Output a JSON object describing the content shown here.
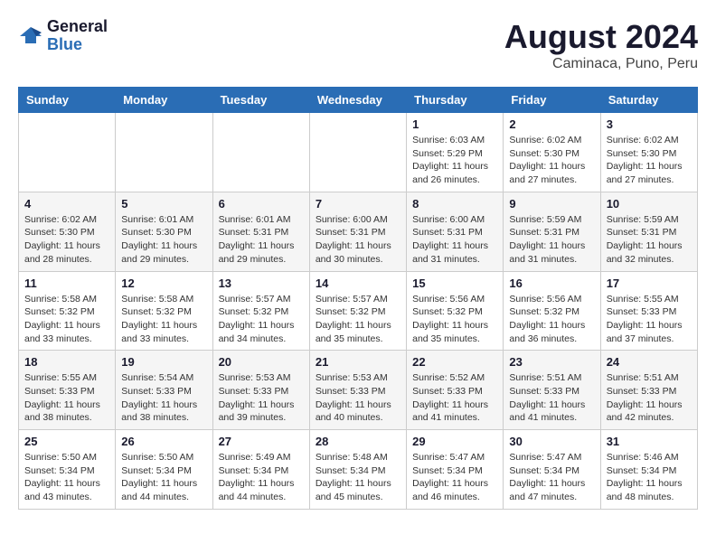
{
  "header": {
    "logo_line1": "General",
    "logo_line2": "Blue",
    "month_year": "August 2024",
    "location": "Caminaca, Puno, Peru"
  },
  "days_of_week": [
    "Sunday",
    "Monday",
    "Tuesday",
    "Wednesday",
    "Thursday",
    "Friday",
    "Saturday"
  ],
  "weeks": [
    [
      {
        "day": "",
        "info": ""
      },
      {
        "day": "",
        "info": ""
      },
      {
        "day": "",
        "info": ""
      },
      {
        "day": "",
        "info": ""
      },
      {
        "day": "1",
        "info": "Sunrise: 6:03 AM\nSunset: 5:29 PM\nDaylight: 11 hours and 26 minutes."
      },
      {
        "day": "2",
        "info": "Sunrise: 6:02 AM\nSunset: 5:30 PM\nDaylight: 11 hours and 27 minutes."
      },
      {
        "day": "3",
        "info": "Sunrise: 6:02 AM\nSunset: 5:30 PM\nDaylight: 11 hours and 27 minutes."
      }
    ],
    [
      {
        "day": "4",
        "info": "Sunrise: 6:02 AM\nSunset: 5:30 PM\nDaylight: 11 hours and 28 minutes."
      },
      {
        "day": "5",
        "info": "Sunrise: 6:01 AM\nSunset: 5:30 PM\nDaylight: 11 hours and 29 minutes."
      },
      {
        "day": "6",
        "info": "Sunrise: 6:01 AM\nSunset: 5:31 PM\nDaylight: 11 hours and 29 minutes."
      },
      {
        "day": "7",
        "info": "Sunrise: 6:00 AM\nSunset: 5:31 PM\nDaylight: 11 hours and 30 minutes."
      },
      {
        "day": "8",
        "info": "Sunrise: 6:00 AM\nSunset: 5:31 PM\nDaylight: 11 hours and 31 minutes."
      },
      {
        "day": "9",
        "info": "Sunrise: 5:59 AM\nSunset: 5:31 PM\nDaylight: 11 hours and 31 minutes."
      },
      {
        "day": "10",
        "info": "Sunrise: 5:59 AM\nSunset: 5:31 PM\nDaylight: 11 hours and 32 minutes."
      }
    ],
    [
      {
        "day": "11",
        "info": "Sunrise: 5:58 AM\nSunset: 5:32 PM\nDaylight: 11 hours and 33 minutes."
      },
      {
        "day": "12",
        "info": "Sunrise: 5:58 AM\nSunset: 5:32 PM\nDaylight: 11 hours and 33 minutes."
      },
      {
        "day": "13",
        "info": "Sunrise: 5:57 AM\nSunset: 5:32 PM\nDaylight: 11 hours and 34 minutes."
      },
      {
        "day": "14",
        "info": "Sunrise: 5:57 AM\nSunset: 5:32 PM\nDaylight: 11 hours and 35 minutes."
      },
      {
        "day": "15",
        "info": "Sunrise: 5:56 AM\nSunset: 5:32 PM\nDaylight: 11 hours and 35 minutes."
      },
      {
        "day": "16",
        "info": "Sunrise: 5:56 AM\nSunset: 5:32 PM\nDaylight: 11 hours and 36 minutes."
      },
      {
        "day": "17",
        "info": "Sunrise: 5:55 AM\nSunset: 5:33 PM\nDaylight: 11 hours and 37 minutes."
      }
    ],
    [
      {
        "day": "18",
        "info": "Sunrise: 5:55 AM\nSunset: 5:33 PM\nDaylight: 11 hours and 38 minutes."
      },
      {
        "day": "19",
        "info": "Sunrise: 5:54 AM\nSunset: 5:33 PM\nDaylight: 11 hours and 38 minutes."
      },
      {
        "day": "20",
        "info": "Sunrise: 5:53 AM\nSunset: 5:33 PM\nDaylight: 11 hours and 39 minutes."
      },
      {
        "day": "21",
        "info": "Sunrise: 5:53 AM\nSunset: 5:33 PM\nDaylight: 11 hours and 40 minutes."
      },
      {
        "day": "22",
        "info": "Sunrise: 5:52 AM\nSunset: 5:33 PM\nDaylight: 11 hours and 41 minutes."
      },
      {
        "day": "23",
        "info": "Sunrise: 5:51 AM\nSunset: 5:33 PM\nDaylight: 11 hours and 41 minutes."
      },
      {
        "day": "24",
        "info": "Sunrise: 5:51 AM\nSunset: 5:33 PM\nDaylight: 11 hours and 42 minutes."
      }
    ],
    [
      {
        "day": "25",
        "info": "Sunrise: 5:50 AM\nSunset: 5:34 PM\nDaylight: 11 hours and 43 minutes."
      },
      {
        "day": "26",
        "info": "Sunrise: 5:50 AM\nSunset: 5:34 PM\nDaylight: 11 hours and 44 minutes."
      },
      {
        "day": "27",
        "info": "Sunrise: 5:49 AM\nSunset: 5:34 PM\nDaylight: 11 hours and 44 minutes."
      },
      {
        "day": "28",
        "info": "Sunrise: 5:48 AM\nSunset: 5:34 PM\nDaylight: 11 hours and 45 minutes."
      },
      {
        "day": "29",
        "info": "Sunrise: 5:47 AM\nSunset: 5:34 PM\nDaylight: 11 hours and 46 minutes."
      },
      {
        "day": "30",
        "info": "Sunrise: 5:47 AM\nSunset: 5:34 PM\nDaylight: 11 hours and 47 minutes."
      },
      {
        "day": "31",
        "info": "Sunrise: 5:46 AM\nSunset: 5:34 PM\nDaylight: 11 hours and 48 minutes."
      }
    ]
  ]
}
